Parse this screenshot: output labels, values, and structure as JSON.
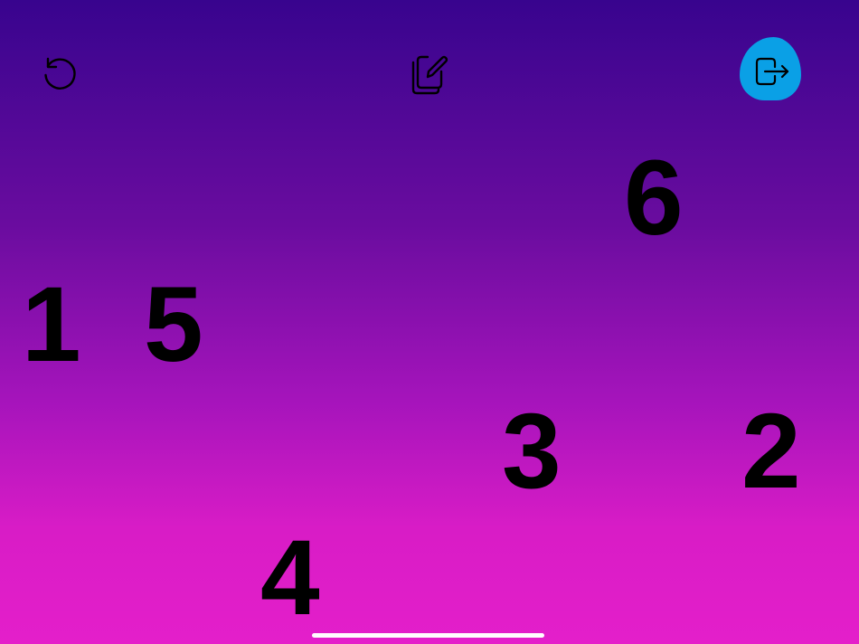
{
  "toolbar": {
    "restart_icon": "restart-icon",
    "edit_icon": "edit-copy-icon",
    "exit_icon": "exit-door-icon",
    "exit_accent": "#0aa0e6"
  },
  "board": {
    "numbers": [
      "6",
      "1",
      "5",
      "3",
      "2",
      "4"
    ]
  },
  "colors": {
    "gradient_top": "#38048e",
    "gradient_bottom": "#e41fca",
    "number_color": "#000000"
  }
}
